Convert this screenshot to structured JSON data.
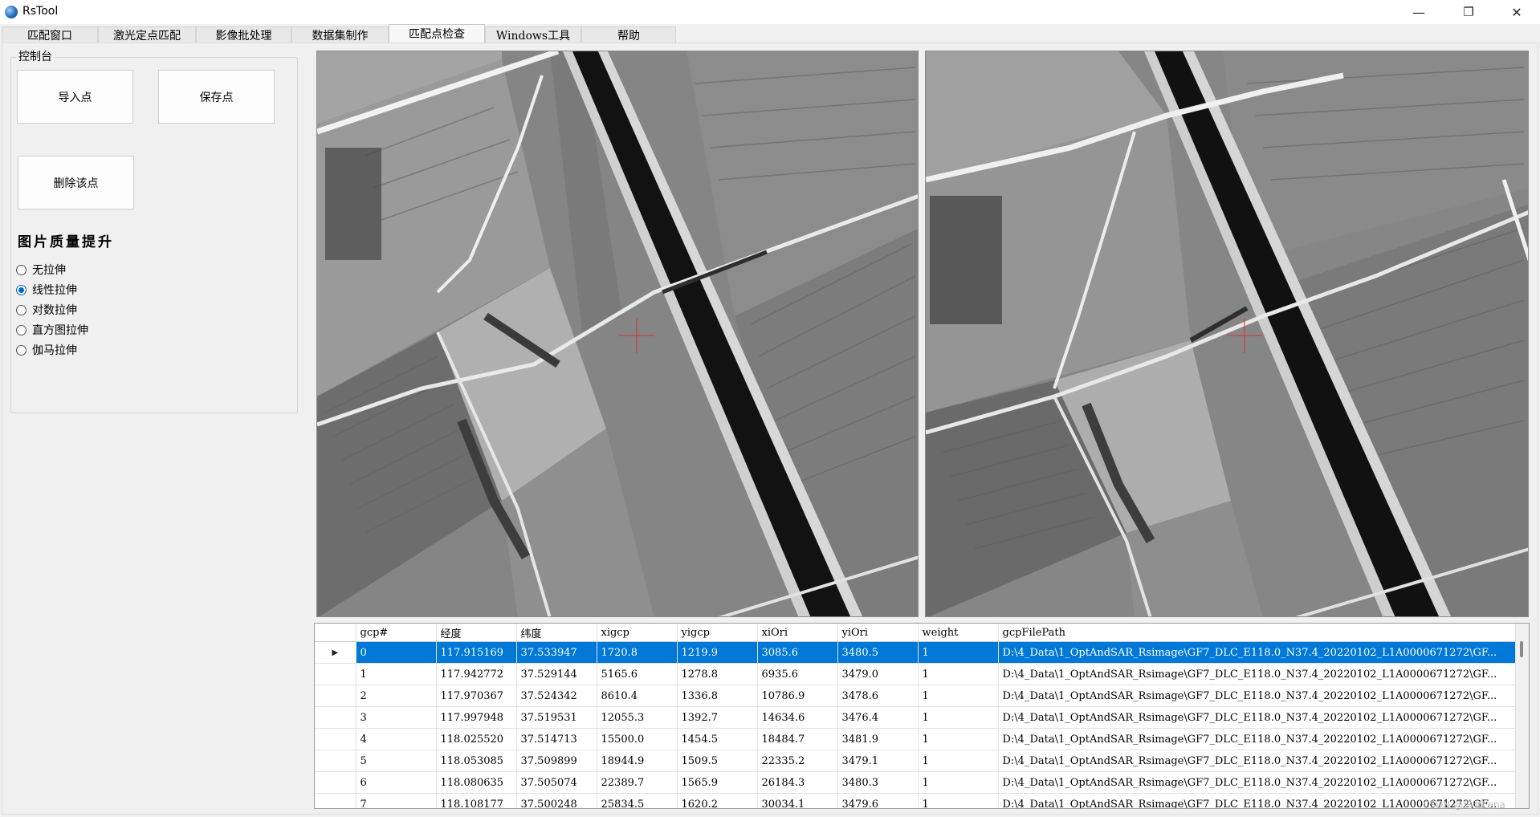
{
  "window": {
    "title": "RsTool",
    "minimize": "—",
    "restore": "❐",
    "close": "✕"
  },
  "tabs": [
    {
      "label": "匹配窗口"
    },
    {
      "label": "激光定点匹配"
    },
    {
      "label": "影像批处理"
    },
    {
      "label": "数据集制作"
    },
    {
      "label": "匹配点检查"
    },
    {
      "label": "Windows工具"
    },
    {
      "label": "帮助"
    }
  ],
  "active_tab": "匹配点检查",
  "console": {
    "legend": "控制台",
    "import_button": "导入点",
    "save_button": "保存点",
    "delete_button": "删除该点",
    "quality_title": "图片质量提升",
    "stretch_options": [
      "无拉伸",
      "线性拉伸",
      "对数拉伸",
      "直方图拉伸",
      "伽马拉伸"
    ],
    "selected_stretch": "线性拉伸"
  },
  "marker_color": "#e03030",
  "selection_color": "#0078d7",
  "grid": {
    "columns": [
      "gcp#",
      "经度",
      "纬度",
      "xigcp",
      "yigcp",
      "xiOri",
      "yiOri",
      "weight",
      "gcpFilePath"
    ],
    "selected_row": 0,
    "current_row_glyph": "▶",
    "rows": [
      [
        "0",
        "117.915169",
        "37.533947",
        "1720.8",
        "1219.9",
        "3085.6",
        "3480.5",
        "1",
        "D:\\4_Data\\1_OptAndSAR_Rsimage\\GF7_DLC_E118.0_N37.4_20220102_L1A0000671272\\GF..."
      ],
      [
        "1",
        "117.942772",
        "37.529144",
        "5165.6",
        "1278.8",
        "6935.6",
        "3479.0",
        "1",
        "D:\\4_Data\\1_OptAndSAR_Rsimage\\GF7_DLC_E118.0_N37.4_20220102_L1A0000671272\\GF..."
      ],
      [
        "2",
        "117.970367",
        "37.524342",
        "8610.4",
        "1336.8",
        "10786.9",
        "3478.6",
        "1",
        "D:\\4_Data\\1_OptAndSAR_Rsimage\\GF7_DLC_E118.0_N37.4_20220102_L1A0000671272\\GF..."
      ],
      [
        "3",
        "117.997948",
        "37.519531",
        "12055.3",
        "1392.7",
        "14634.6",
        "3476.4",
        "1",
        "D:\\4_Data\\1_OptAndSAR_Rsimage\\GF7_DLC_E118.0_N37.4_20220102_L1A0000671272\\GF..."
      ],
      [
        "4",
        "118.025520",
        "37.514713",
        "15500.0",
        "1454.5",
        "18484.7",
        "3481.9",
        "1",
        "D:\\4_Data\\1_OptAndSAR_Rsimage\\GF7_DLC_E118.0_N37.4_20220102_L1A0000671272\\GF..."
      ],
      [
        "5",
        "118.053085",
        "37.509899",
        "18944.9",
        "1509.5",
        "22335.2",
        "3479.1",
        "1",
        "D:\\4_Data\\1_OptAndSAR_Rsimage\\GF7_DLC_E118.0_N37.4_20220102_L1A0000671272\\GF..."
      ],
      [
        "6",
        "118.080635",
        "37.505074",
        "22389.7",
        "1565.9",
        "26184.3",
        "3480.3",
        "1",
        "D:\\4_Data\\1_OptAndSAR_Rsimage\\GF7_DLC_E118.0_N37.4_20220102_L1A0000671272\\GF..."
      ],
      [
        "7",
        "118.108177",
        "37.500248",
        "25834.5",
        "1620.2",
        "30034.1",
        "3479.6",
        "1",
        "D:\\4_Data\\1_OptAndSAR_Rsimage\\GF7_DLC_E118.0_N37.4_20220102_L1A0000671272\\GF..."
      ]
    ]
  },
  "watermark": "CSDN @玛咖Lena"
}
